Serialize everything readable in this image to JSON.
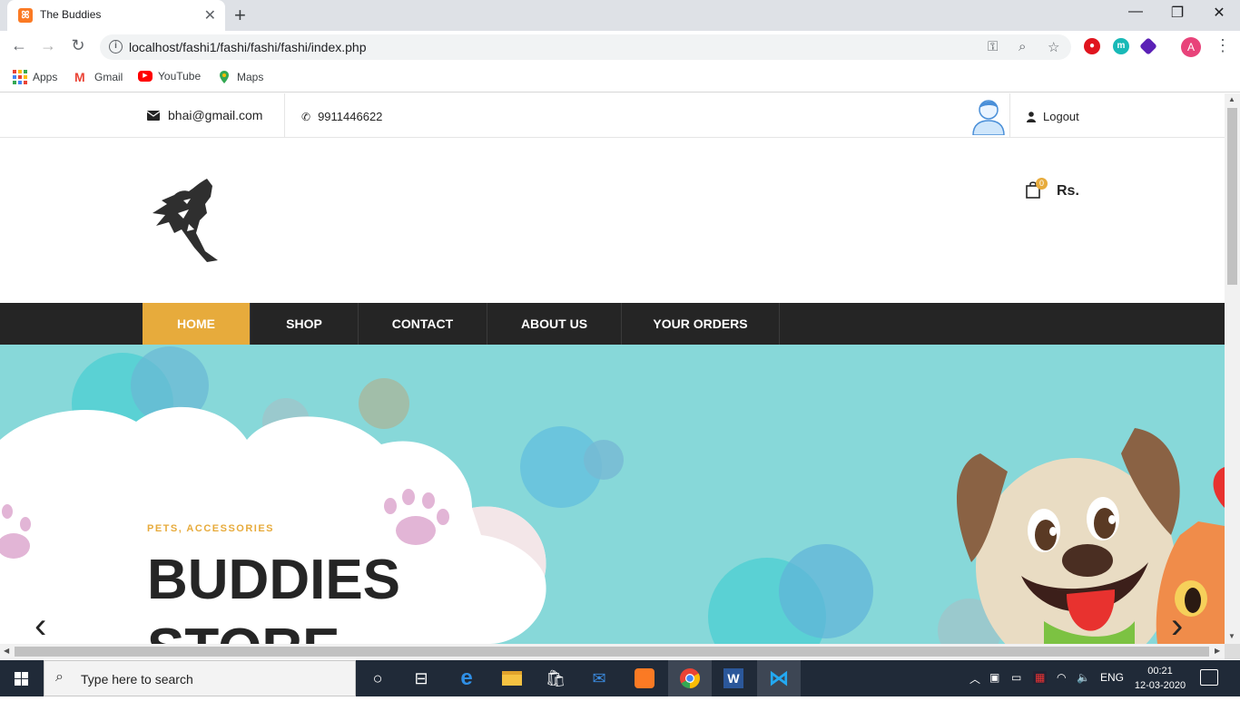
{
  "browser": {
    "tab_title": "The Buddies",
    "tab_close": "✕",
    "new_tab": "+",
    "url": "localhost/fashi1/fashi/fashi/fashi/index.php",
    "profile_initial": "A",
    "window_controls": {
      "minimize": "—",
      "restore": "❐",
      "close": "✕"
    },
    "bookmarks": [
      {
        "label": "Apps",
        "icon": "apps-grid-icon"
      },
      {
        "label": "Gmail",
        "icon": "gmail-icon"
      },
      {
        "label": "YouTube",
        "icon": "youtube-icon"
      },
      {
        "label": "Maps",
        "icon": "maps-pin-icon"
      }
    ]
  },
  "site": {
    "topbar": {
      "email": "bhai@gmail.com",
      "phone": "9911446622",
      "logout": "Logout"
    },
    "cart": {
      "count": "0",
      "price_label": "Rs."
    },
    "nav": [
      {
        "label": "HOME",
        "active": true
      },
      {
        "label": "SHOP",
        "active": false
      },
      {
        "label": "CONTACT",
        "active": false
      },
      {
        "label": "ABOUT US",
        "active": false
      },
      {
        "label": "YOUR ORDERS",
        "active": false
      }
    ],
    "hero": {
      "tag": "PETS, ACCESSORIES",
      "title": "BUDDIES STORE",
      "prev": "‹",
      "next": "›"
    }
  },
  "taskbar": {
    "search_placeholder": "Type here to search",
    "language": "ENG",
    "time": "00:21",
    "date": "12-03-2020"
  },
  "colors": {
    "accent": "#e7ab3c",
    "nav_bg": "#252525",
    "hero_bg": "#87d8d9",
    "taskbar_bg": "#202a38"
  }
}
